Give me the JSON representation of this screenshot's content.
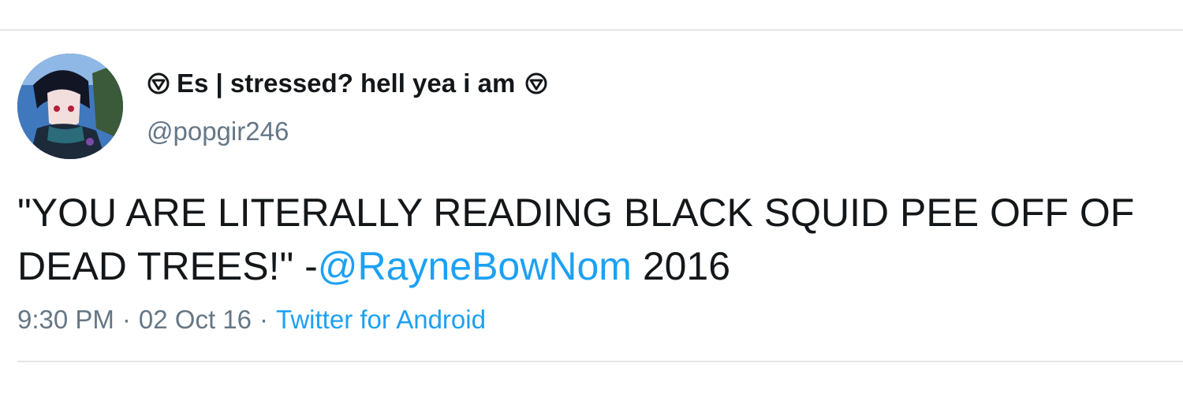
{
  "author": {
    "display_name": "Es | stressed? hell yea i am",
    "name_icon": "down-triangle-in-circle-icon",
    "handle": "@popgir246",
    "avatar": "anime-character-avatar"
  },
  "tweet": {
    "text_before": "\"YOU ARE LITERALLY READING BLACK SQUID PEE OFF OF DEAD TREES!\" -",
    "mention": "@RayneBowNom",
    "text_after": " 2016"
  },
  "meta": {
    "time": "9:30 PM",
    "separator": "·",
    "date": "02 Oct 16",
    "source": "Twitter for Android"
  },
  "colors": {
    "link": "#1da1f2",
    "text": "#14171a",
    "muted": "#657786"
  }
}
